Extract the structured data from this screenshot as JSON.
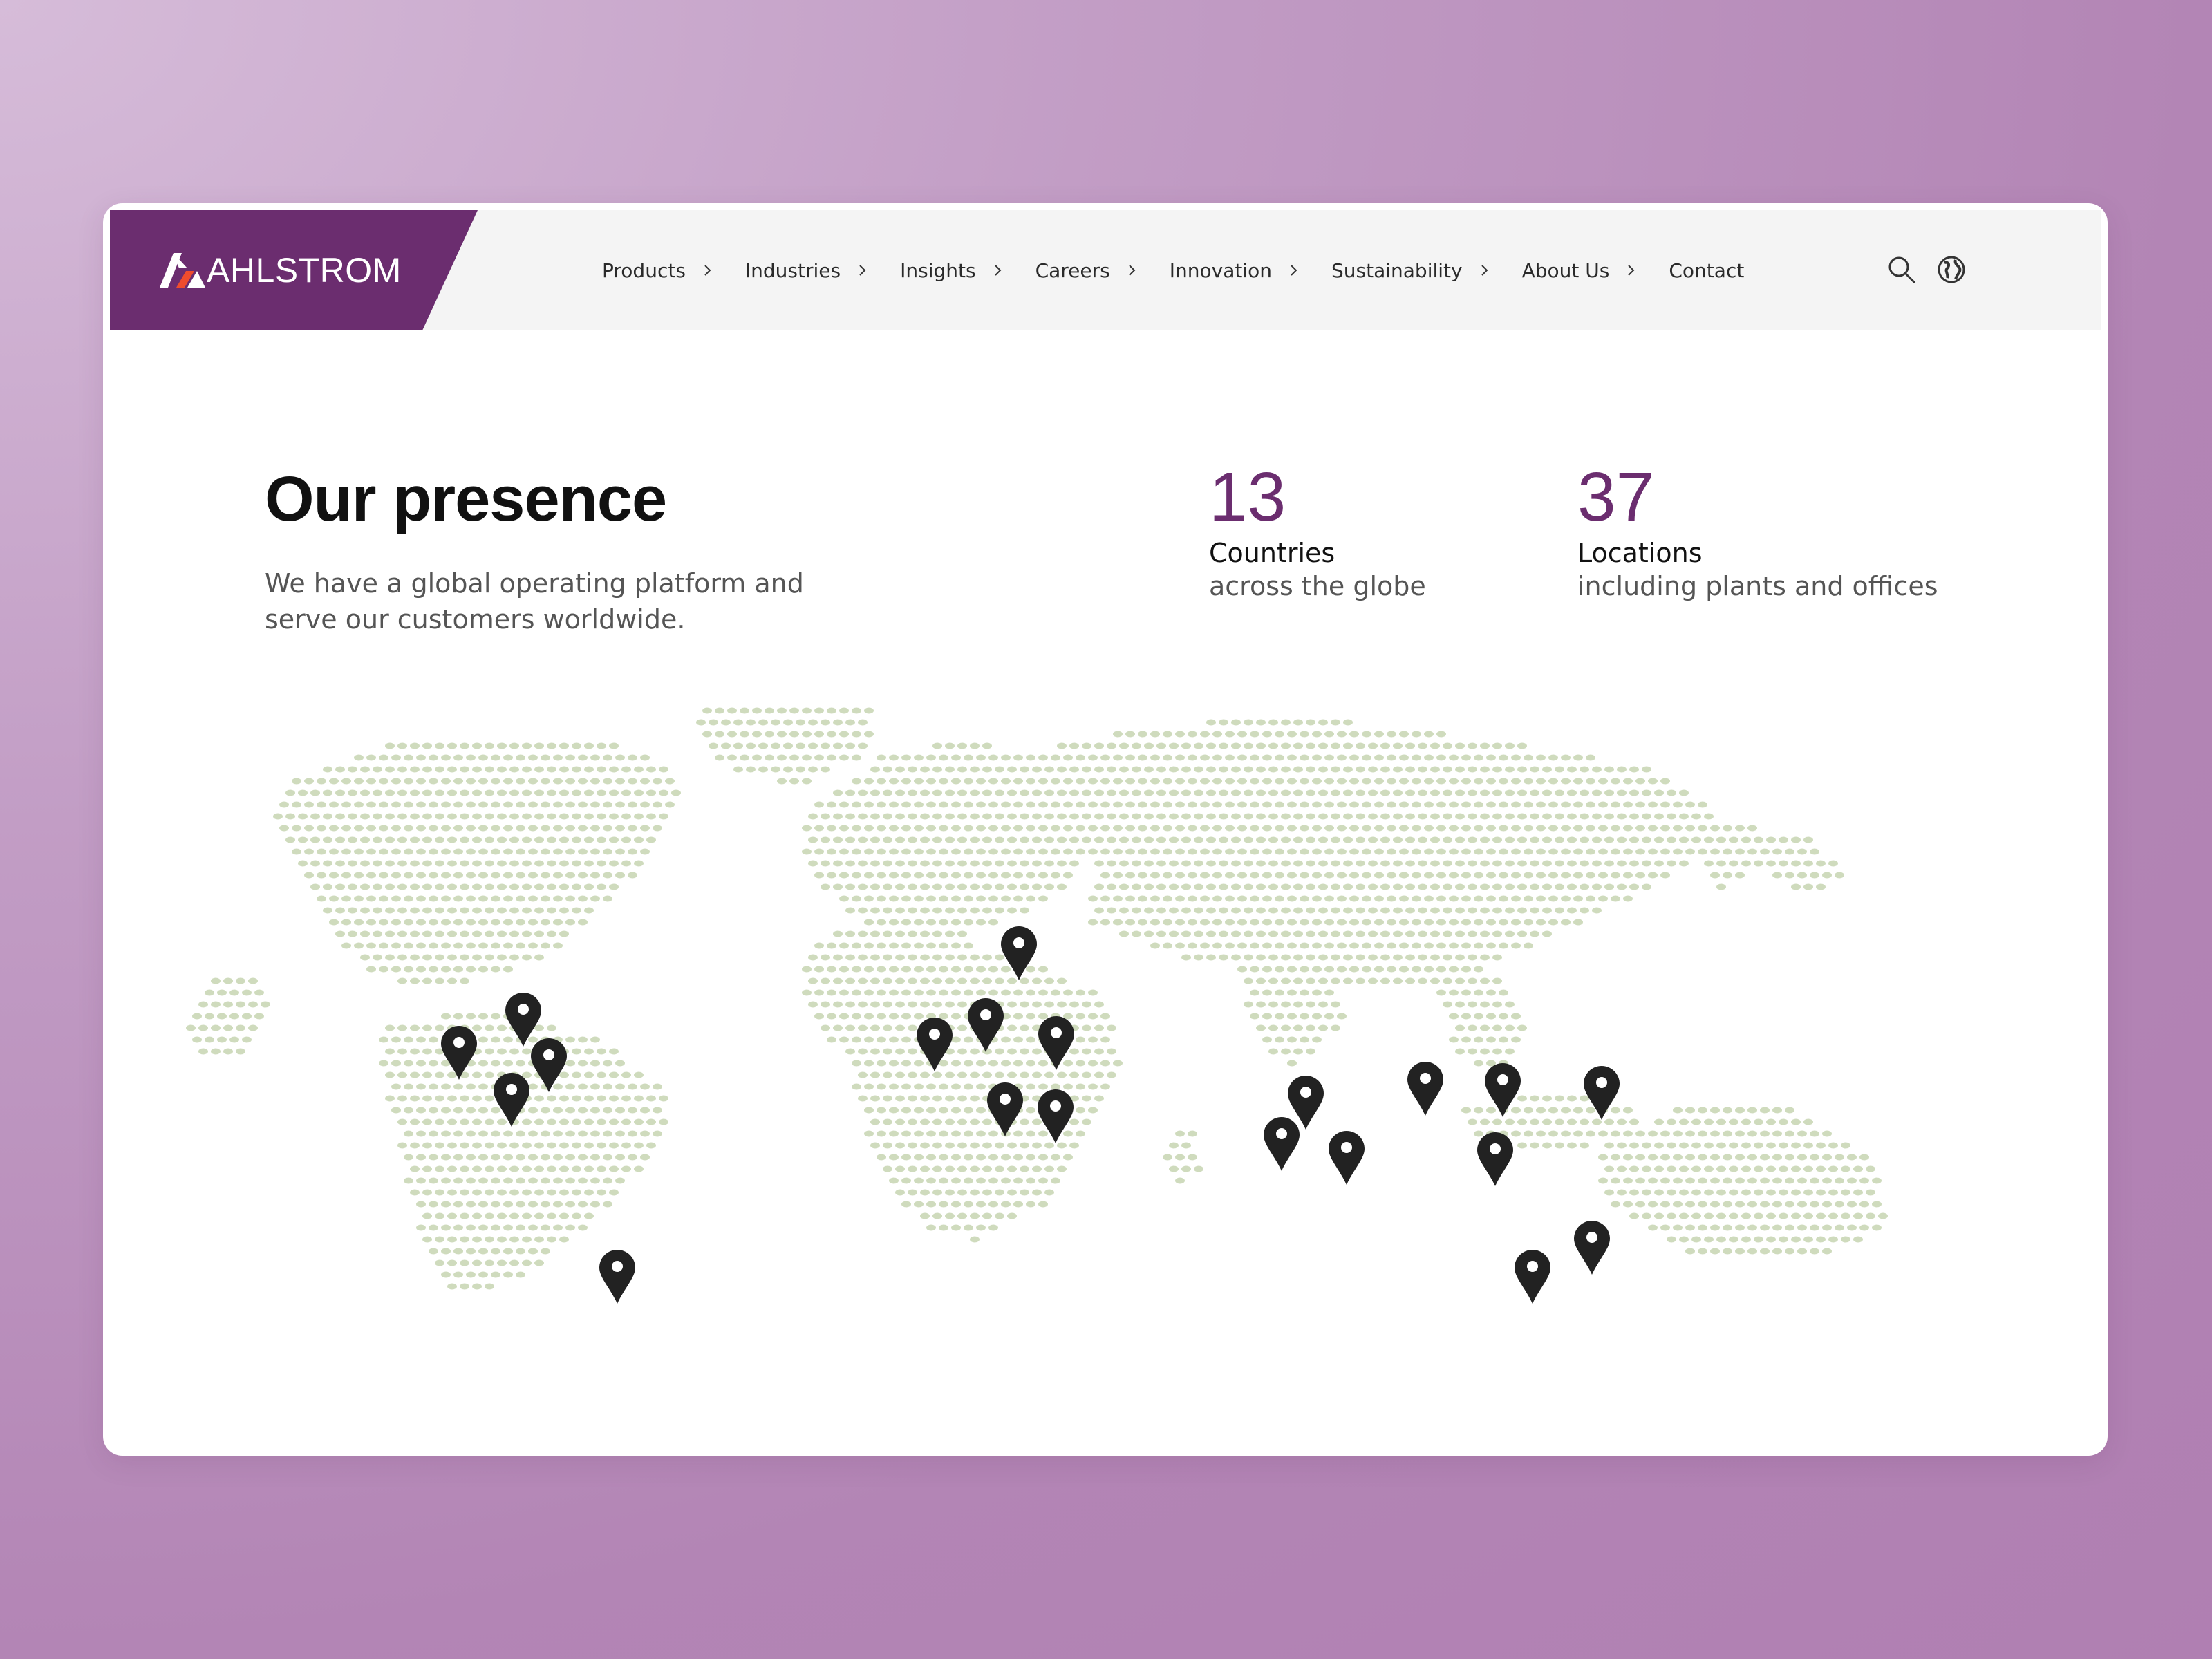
{
  "brand": {
    "name": "AHLSTROM",
    "color": "#6b2d6f",
    "accent": "#ef4c2d"
  },
  "nav": {
    "items": [
      {
        "label": "Products",
        "has_submenu": true
      },
      {
        "label": "Industries",
        "has_submenu": true
      },
      {
        "label": "Insights",
        "has_submenu": true
      },
      {
        "label": "Careers",
        "has_submenu": true
      },
      {
        "label": "Innovation",
        "has_submenu": true
      },
      {
        "label": "Sustainability",
        "has_submenu": true
      },
      {
        "label": "About Us",
        "has_submenu": true
      },
      {
        "label": "Contact",
        "has_submenu": false
      }
    ]
  },
  "utilities": {
    "search_icon": "search-icon",
    "language_icon": "globe-icon"
  },
  "presence": {
    "title": "Our presence",
    "subtitle": "We have a global operating platform and serve our customers worldwide."
  },
  "stats": [
    {
      "value": "13",
      "label": "Countries",
      "description": "across the globe"
    },
    {
      "value": "37",
      "label": "Locations",
      "description": "including plants and offices"
    }
  ],
  "map": {
    "land_color": "#cfdbbd",
    "pin_color": "#222222",
    "pin_count": 20
  }
}
